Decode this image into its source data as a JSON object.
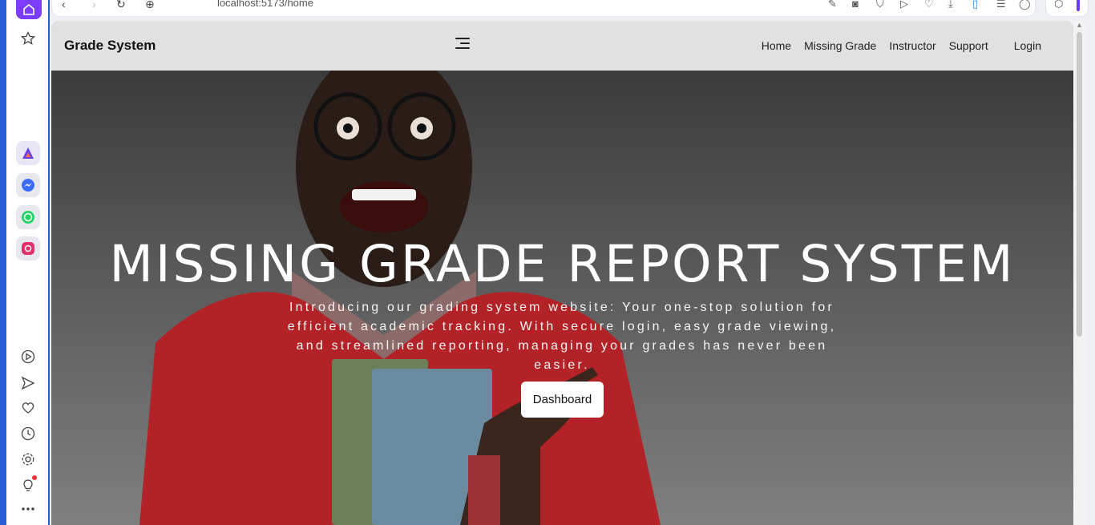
{
  "browser": {
    "url": "localhost:5173/home",
    "sidebar_icons": [
      "home-icon",
      "star-icon",
      "app-a-icon",
      "messenger-icon",
      "whatsapp-icon",
      "instagram-icon",
      "play-icon",
      "send-icon",
      "heart-icon",
      "clock-icon",
      "gear-icon",
      "lightbulb-icon",
      "more-icon"
    ],
    "toolbar_icons": [
      "back-icon",
      "forward-icon",
      "reload-icon",
      "globe-icon",
      "edit-icon",
      "camera-icon",
      "shield-icon",
      "play-icon",
      "heart-icon",
      "download-icon",
      "bookmark-icon",
      "settings-icon",
      "profile-icon",
      "cube-icon"
    ]
  },
  "navbar": {
    "brand": "Grade System",
    "links": [
      "Home",
      "Missing Grade",
      "Instructor",
      "Support"
    ],
    "login": "Login"
  },
  "hero": {
    "title": "MISSING GRADE REPORT SYSTEM",
    "description": "Introducing our grading system website: Your one-stop solution for efficient academic tracking. With secure login, easy grade viewing, and streamlined reporting, managing your grades has never been easier.",
    "button": "Dashboard"
  },
  "colors": {
    "sidebar_accent": "#7b3cff",
    "sidebar_border": "#2a5bd6",
    "navbar_bg": "#e1e1e1",
    "shirt": "#c8282c"
  }
}
